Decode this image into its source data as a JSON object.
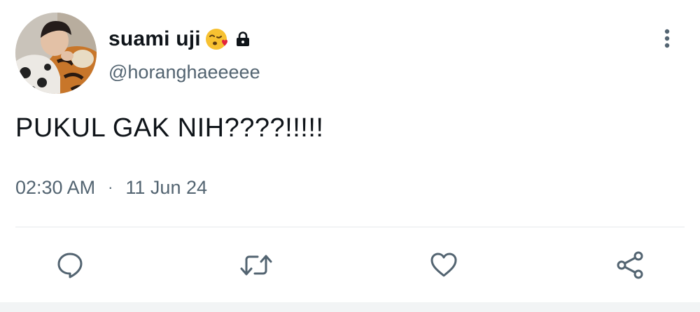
{
  "tweet": {
    "display_name": "suami uji",
    "handle": "@horanghaeeeee",
    "text": "PUKUL GAK NIH????!!!!!",
    "time": "02:30 AM",
    "separator": "·",
    "date": "11 Jun 24"
  },
  "icons": {
    "emoji": "face-blowing-kiss-emoji",
    "protected": "lock-icon",
    "more": "more-vertical-icon",
    "reply": "reply-icon",
    "retweet": "retweet-icon",
    "like": "heart-icon",
    "share": "share-icon"
  },
  "colors": {
    "text_primary": "#0f1419",
    "text_secondary": "#536471",
    "divider": "#e6e9ec",
    "action_icon": "#536471"
  }
}
